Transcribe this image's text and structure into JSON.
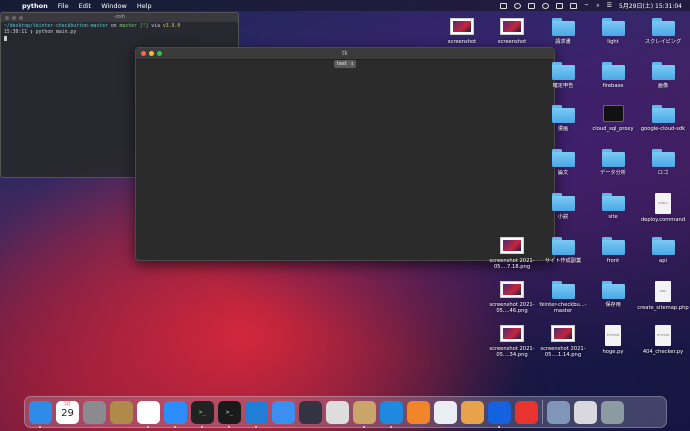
{
  "menubar": {
    "app_name": "python",
    "menus": [
      "File",
      "Edit",
      "Window",
      "Help"
    ],
    "datetime": "5月29日(土)  15:31:04"
  },
  "terminal": {
    "title": "-zsh",
    "line1_path": "~/desktop/tkinter-checkbutton-master",
    "line1_on": " on ",
    "line1_branch": "master [!]",
    "line1_via": " via ",
    "line1_version": "v3.9.0",
    "line2_time": "15:30:11",
    "line2_cmd": " ❯ python main.py"
  },
  "tk_window": {
    "title": "tk",
    "button_label": "test"
  },
  "desktop_icons": [
    {
      "label": "screenshot",
      "kind": "thumb"
    },
    {
      "label": "screenshot",
      "kind": "thumb"
    },
    {
      "label": "請求書",
      "kind": "folder"
    },
    {
      "label": "light",
      "kind": "folder"
    },
    {
      "label": "スクレイピング",
      "kind": "folder"
    },
    {
      "label": "確定申告",
      "kind": "folder"
    },
    {
      "label": "firebase",
      "kind": "folder"
    },
    {
      "label": "画像",
      "kind": "folder"
    },
    {
      "label": "漫画",
      "kind": "folder"
    },
    {
      "label": "cloud_sql_proxy",
      "kind": "terminal"
    },
    {
      "label": "google-cloud-sdk",
      "kind": "folder"
    },
    {
      "label": "論文",
      "kind": "folder"
    },
    {
      "label": "データ分析",
      "kind": "folder"
    },
    {
      "label": "ロゴ",
      "kind": "folder"
    },
    {
      "label": "小説",
      "kind": "folder"
    },
    {
      "label": "site",
      "kind": "folder"
    },
    {
      "label": "deploy.command",
      "kind": "doc",
      "doc_tag": "SHELL"
    },
    {
      "label": "screenshot 2021-05....7.18.png",
      "kind": "thumb"
    },
    {
      "label": "サイト作成副業",
      "kind": "folder"
    },
    {
      "label": "front",
      "kind": "folder"
    },
    {
      "label": "api",
      "kind": "folder"
    },
    {
      "label": "screenshot 2021-05....46.png",
      "kind": "thumb"
    },
    {
      "label": "tkinter-checkbu...-master",
      "kind": "folder"
    },
    {
      "label": "保存用",
      "kind": "folder"
    },
    {
      "label": "create_sitemap.php",
      "kind": "doc",
      "doc_tag": "PHP"
    },
    {
      "label": "screenshot 2021-05....34.png",
      "kind": "thumb"
    },
    {
      "label": "screenshot 2021-05....1.14.png",
      "kind": "thumb"
    },
    {
      "label": "hoge.py",
      "kind": "doc",
      "doc_tag": "PYTHON"
    },
    {
      "label": "404_checker.py",
      "kind": "doc",
      "doc_tag": "PYTHON"
    }
  ],
  "dock": {
    "calendar_day": "29",
    "calendar_month": "5月",
    "terminal_prompt": ">_",
    "apps": [
      {
        "name": "finder",
        "color": "#2f8be8",
        "active": true
      },
      {
        "name": "calendar",
        "color": "#ffffff",
        "active": false
      },
      {
        "name": "system-preferences",
        "color": "#8a8a8f",
        "active": false
      },
      {
        "name": "archive",
        "color": "#b08a4a",
        "active": false
      },
      {
        "name": "chrome",
        "color": "#ffffff",
        "active": true
      },
      {
        "name": "zoom",
        "color": "#2d8cff",
        "active": true
      },
      {
        "name": "iterm",
        "color": "#222222",
        "active": true
      },
      {
        "name": "terminal",
        "color": "#1a1a1a",
        "active": true
      },
      {
        "name": "vscode",
        "color": "#1f7fd4",
        "active": true
      },
      {
        "name": "safari",
        "color": "#3b8ff0",
        "active": false
      },
      {
        "name": "quicktime",
        "color": "#334",
        "active": false
      },
      {
        "name": "sequel",
        "color": "#ddd",
        "active": false
      },
      {
        "name": "python-launcher",
        "color": "#caa56a",
        "active": true
      },
      {
        "name": "docker",
        "color": "#1d8ae0",
        "active": true
      },
      {
        "name": "sourcetree",
        "color": "#f0852a",
        "active": false
      },
      {
        "name": "postgres",
        "color": "#e9eef5",
        "active": false
      },
      {
        "name": "preview",
        "color": "#e8a24a",
        "active": false
      },
      {
        "name": "infinity",
        "color": "#1562e0",
        "active": true
      },
      {
        "name": "clock",
        "color": "#e8342e",
        "active": false
      }
    ]
  }
}
